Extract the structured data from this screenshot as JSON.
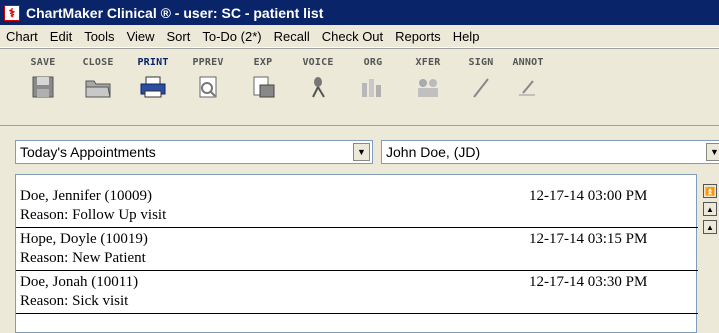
{
  "window": {
    "title": "ChartMaker Clinical ® - user: SC - patient list"
  },
  "menu": [
    "Chart",
    "Edit",
    "Tools",
    "View",
    "Sort",
    "To-Do (2*)",
    "Recall",
    "Check Out",
    "Reports",
    "Help"
  ],
  "toolbar": {
    "save": "SAVE",
    "close": "CLOSE",
    "print": "PRINT",
    "pprev": "PPREV",
    "exp": "EXP",
    "voice": "VOICE",
    "org": "ORG",
    "xfer": "XFER",
    "sign": "SIGN",
    "annot": "ANNOT"
  },
  "filters": {
    "view": "Today's Appointments",
    "provider": "John Doe, (JD)"
  },
  "appointments": [
    {
      "name": "Doe, Jennifer (10009)",
      "datetime": "12-17-14  03:00 PM",
      "reason": "Reason: Follow Up visit"
    },
    {
      "name": "Hope, Doyle (10019)",
      "datetime": "12-17-14  03:15 PM",
      "reason": "Reason: New Patient"
    },
    {
      "name": "Doe, Jonah (10011)",
      "datetime": "12-17-14  03:30 PM",
      "reason": "Reason: Sick visit"
    }
  ]
}
